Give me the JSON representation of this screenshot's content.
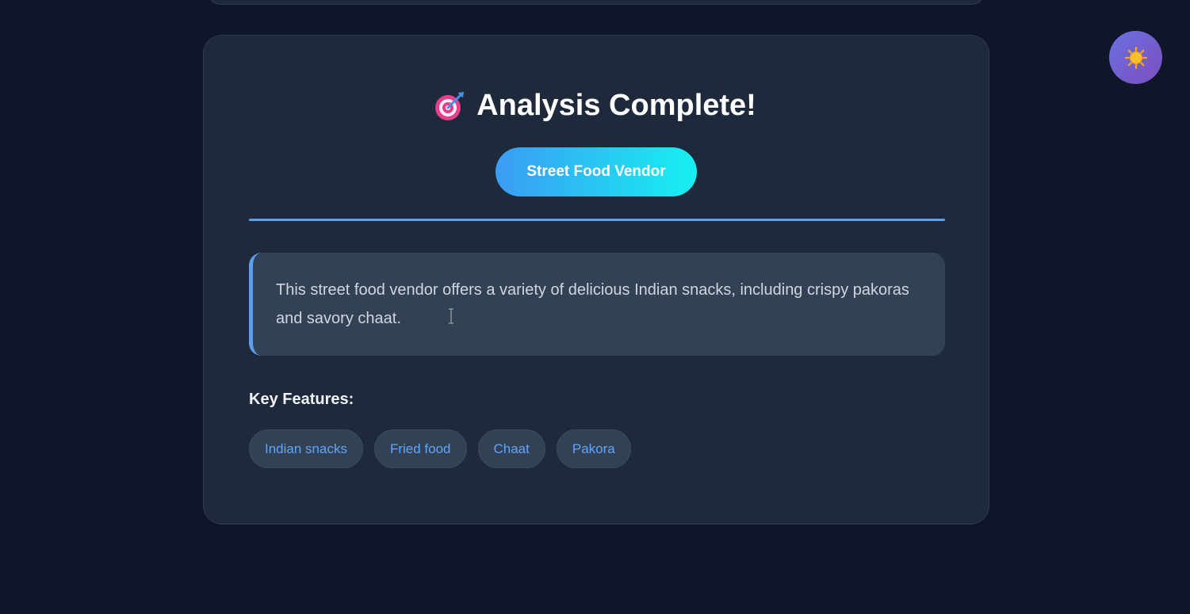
{
  "result": {
    "heading_icon": "target-dart-icon",
    "heading": "Analysis Complete!",
    "category": "Street Food Vendor",
    "description": "This street food vendor offers a variety of delicious Indian snacks, including crispy pakoras and savory chaat.",
    "features_label": "Key Features:",
    "features": [
      "Indian snacks",
      "Fried food",
      "Chaat",
      "Pakora"
    ]
  },
  "theme_toggle": {
    "icon": "sun-icon"
  },
  "colors": {
    "background": "#0f1629",
    "card": "#1e293b",
    "accent": "#5aa0ee",
    "tag_text": "#60a5fa",
    "badge_gradient_start": "#3b9cf5",
    "badge_gradient_end": "#16f0f0"
  }
}
